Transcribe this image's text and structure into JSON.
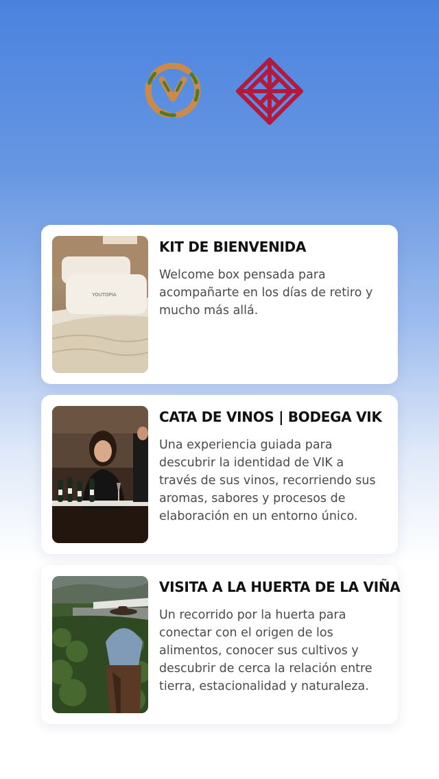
{
  "header": {
    "logos": [
      {
        "name": "vineyard-ring-logo",
        "icon": "ring-logo"
      },
      {
        "name": "bodega-vik-logo",
        "icon": "vik-diamond-logo",
        "color": "#b11a3f"
      }
    ]
  },
  "experiences": [
    {
      "title": "KIT DE BIENVENIDA",
      "description": "Welcome box pensada para acompañarte en los días de retiro y mucho más allá.",
      "image": "bed-with-youtopia-pillow",
      "pillow_text": "YOUTOPIA"
    },
    {
      "title": "CATA DE VINOS | BODEGA VIK",
      "description": "Una experiencia guiada para descubrir la identidad de VIK a través de sus vinos, recorriendo sus aromas, sabores y procesos de elaboración en un entorno único.",
      "image": "wine-tasting-woman"
    },
    {
      "title": "VISITA A LA HUERTA DE LA VIÑA",
      "description": "Un recorrido por la huerta para conectar con el origen de los alimentos, conocer sus cultivos y descubrir de cerca la relación entre tierra, estacionalidad y naturaleza.",
      "image": "horseback-rider-in-vineyard"
    }
  ],
  "colors": {
    "accent": "#b11a3f",
    "title": "#111111",
    "text": "#4a4a4a"
  }
}
